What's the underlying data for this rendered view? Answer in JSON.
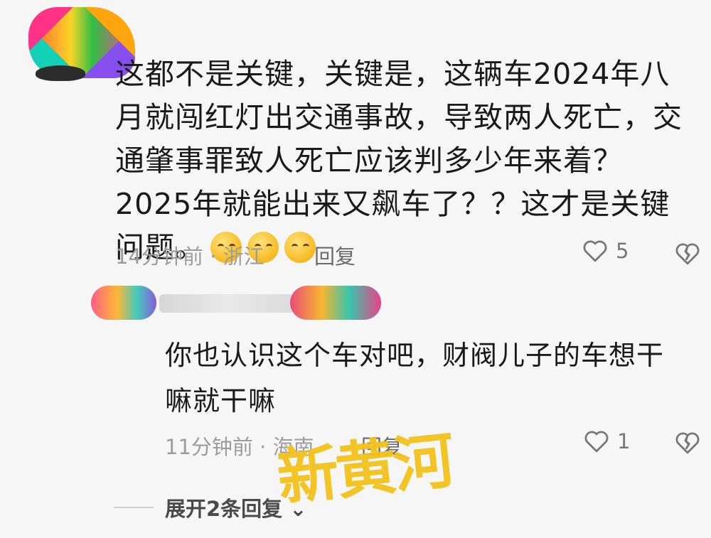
{
  "comment": {
    "text": "这都不是关键，关键是，这辆车2024年八月就闯红灯出交通事故，导致两人死亡，交通肇事罪致人死亡应该判多少年来着？2025年就能出来又飙车了？？这才是关键问题。",
    "emoji_count": 3,
    "time": "14分钟前",
    "location": "浙江",
    "reply_label": "回复",
    "like_count": "5"
  },
  "reply": {
    "text": "你也认识这个车对吧，财阀儿子的车想干嘛就干嘛",
    "time": "11分钟前",
    "location": "海南",
    "reply_label": "回复",
    "like_count": "1"
  },
  "expand_label": "展开2条回复",
  "watermark": "新黄河",
  "colors": {
    "background": "#f6f6f6",
    "meta_text": "#9c9c9c",
    "watermark": "#f2c21b"
  }
}
